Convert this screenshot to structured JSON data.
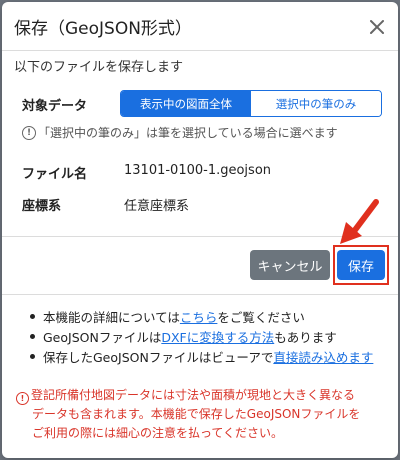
{
  "dialog": {
    "title": "保存（GeoJSON形式）",
    "intro": "以下のファイルを保存します"
  },
  "target": {
    "label": "対象データ",
    "options": [
      "表示中の図面全体",
      "選択中の筆のみ"
    ],
    "selected": "表示中の図面全体",
    "hint": "「選択中の筆のみ」は筆を選択している場合に選べます"
  },
  "file": {
    "label": "ファイル名",
    "value": "13101-0100-1.geojson"
  },
  "crs": {
    "label": "座標系",
    "value": "任意座標系"
  },
  "buttons": {
    "cancel": "キャンセル",
    "save": "保存"
  },
  "notes": [
    {
      "before": "本機能の詳細については ",
      "link": "こちら",
      "after": " をご覧ください"
    },
    {
      "before": "GeoJSONファイルは ",
      "link": "DXFに変換する方法",
      "after": " もあります"
    },
    {
      "before": "保存したGeoJSONファイルはビューアで ",
      "link": "直接読み込めます",
      "after": ""
    }
  ],
  "warning": {
    "lines": [
      "登記所備付地図データには寸法や面積が現地と大きく異なる",
      "データも含まれます。本機能で保存したGeoJSONファイルを",
      "ご利用の際には細心の注意を払ってください。"
    ]
  },
  "colors": {
    "primary": "#1a6fe0",
    "secondary": "#6c757d",
    "warning": "#d9352a",
    "highlight": "#e0301e"
  }
}
